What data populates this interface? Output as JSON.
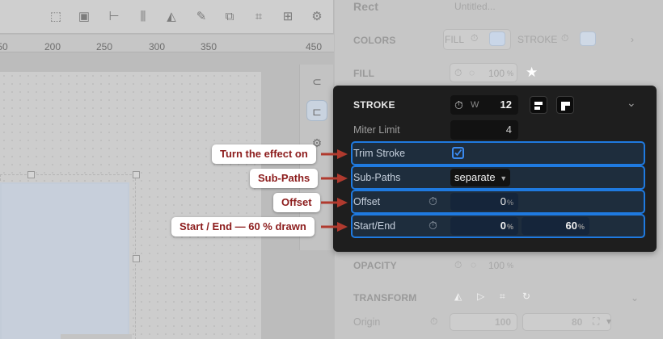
{
  "ruler": {
    "labels": [
      "50",
      "200",
      "250",
      "300",
      "350",
      "450"
    ]
  },
  "panel": {
    "object_name": "Rect",
    "object_title_placeholder": "Untitled...",
    "colors_title": "COLORS",
    "colors_fill_label": "FILL",
    "colors_stroke_label": "STROKE",
    "fill_title": "FILL",
    "fill_value": "100",
    "fill_unit": "%",
    "opacity_title": "OPACITY",
    "opacity_value": "100",
    "opacity_unit": "%",
    "transform_title": "TRANSFORM",
    "origin_label": "Origin",
    "origin_x": "100",
    "origin_y": "80"
  },
  "stroke": {
    "title": "STROKE",
    "width_label": "W",
    "width_value": "12",
    "miter_label": "Miter Limit",
    "miter_value": "4",
    "trim_label": "Trim Stroke",
    "trim_checked": true,
    "subpaths_label": "Sub-Paths",
    "subpaths_value": "separate",
    "offset_label": "Offset",
    "offset_value": "0",
    "start_end_label": "Start/End",
    "start_value": "0",
    "end_value": "60",
    "unit": "%"
  },
  "callouts": {
    "trim": "Turn the effect on",
    "subpaths": "Sub-Paths",
    "offset": "Offset",
    "start_end": "Start / End — 60 % drawn"
  },
  "colors": {
    "accent": "#1f7ae0",
    "callout_text": "#8c1c1c",
    "arrow": "#b03a2e"
  }
}
